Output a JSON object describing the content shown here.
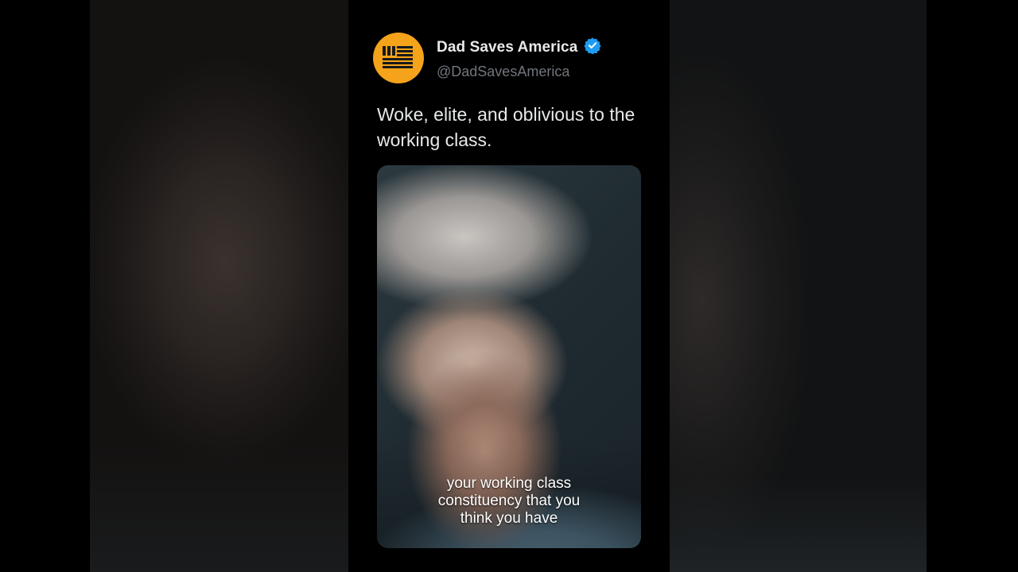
{
  "tweet": {
    "author_name": "Dad Saves America",
    "handle": "@DadSavesAmerica",
    "verified": true,
    "avatar_icon": "striped-flag-logo-icon",
    "text": "Woke, elite, and oblivious to the working class."
  },
  "video": {
    "captions": [
      "your working class",
      "constituency that you",
      "think you have"
    ]
  },
  "colors": {
    "background": "#000000",
    "avatar": "#f5a31a",
    "verified_badge": "#1d9bf0",
    "name_text": "#e7e9ea",
    "handle_text": "#71767b"
  }
}
